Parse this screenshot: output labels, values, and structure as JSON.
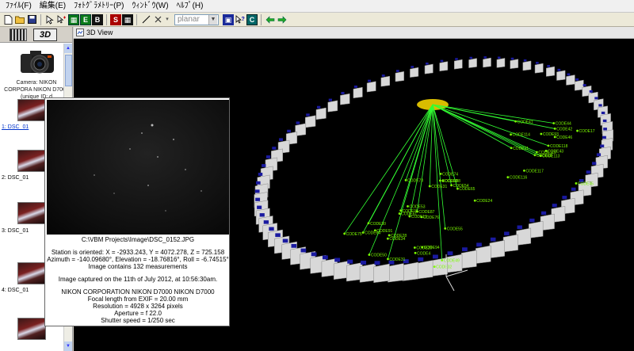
{
  "menu": {
    "items": [
      "ﾌｧｲﾙ(F)",
      "編集(E)",
      "ﾌｫﾄｸﾞﾗﾒﾄﾘｰ(P)",
      "ｳｨﾝﾄﾞｳ(W)",
      "ﾍﾙﾌﾟ(H)"
    ]
  },
  "toolbar": {
    "projection_value": "planar",
    "icon_labels": {
      "b1": "E",
      "b2": "B",
      "b3": "S",
      "b4": "C"
    }
  },
  "left_panel": {
    "view_button_3d": "3D",
    "camera_caption": "Camera: NIKON CORPORA NIKON D7000 (unique ID: d",
    "photos": [
      {
        "label": "1: DSC_01"
      },
      {
        "label": "2: DSC_01"
      },
      {
        "label": "3: DSC_01"
      },
      {
        "label": "4: DSC_01"
      }
    ]
  },
  "view": {
    "title": "3D View",
    "code_labels": [
      "CODE113",
      "CODE114",
      "CODE119",
      "CODE116",
      "CODE118",
      "CODE117",
      "CODE44",
      "CODE93",
      "CODE42",
      "CODE43",
      "CODE41",
      "CODE45",
      "CODE21",
      "CODE17",
      "CODE18",
      "CODE46",
      "CODE19",
      "CODE20",
      "CODE54",
      "CODE53",
      "CODE31",
      "CODE51",
      "CODE87",
      "CODE88",
      "CODE65",
      "CODE24",
      "CODE73",
      "CODE74",
      "CODE75",
      "CODE29",
      "CODE55",
      "CODE34",
      "CODE31",
      "CODE28",
      "CODE30",
      "CODE76",
      "CODE50",
      "CODE32",
      "CODE49",
      "CODE94",
      "CODE95",
      "CODE91",
      "CODE64",
      "CODE4"
    ]
  },
  "popup": {
    "path": "C:\\VBM Projects\\Image\\DSC_0152.JPG",
    "line1": "Station is oriented: X = -2933.243, Y = 4072.278, Z = 725.158",
    "line2": "Azimuth = -140.09680°, Elevation = -18.76816°, Roll = -6.74515°",
    "line3": "Image contains 132 measurements",
    "line4": "Image captured on the 11th of July 2012, at 10:56:30am.",
    "line5": "NIKON CORPORATION NIKON D7000 NIKON D7000",
    "line6": "Focal length from EXIF = 20.00 mm",
    "line7": "Resolution = 4928 x 3264 pixels",
    "line8": "Aperture = f 22.0",
    "line9": "Shutter speed = 1/250 sec"
  },
  "colors": {
    "background_3d": "#000000",
    "rays": "#33ff33",
    "targets": "#7cfc00",
    "blocks": "#d8d8d8",
    "markers": "#1a1aa0",
    "camera_cluster": "#f0d000"
  }
}
